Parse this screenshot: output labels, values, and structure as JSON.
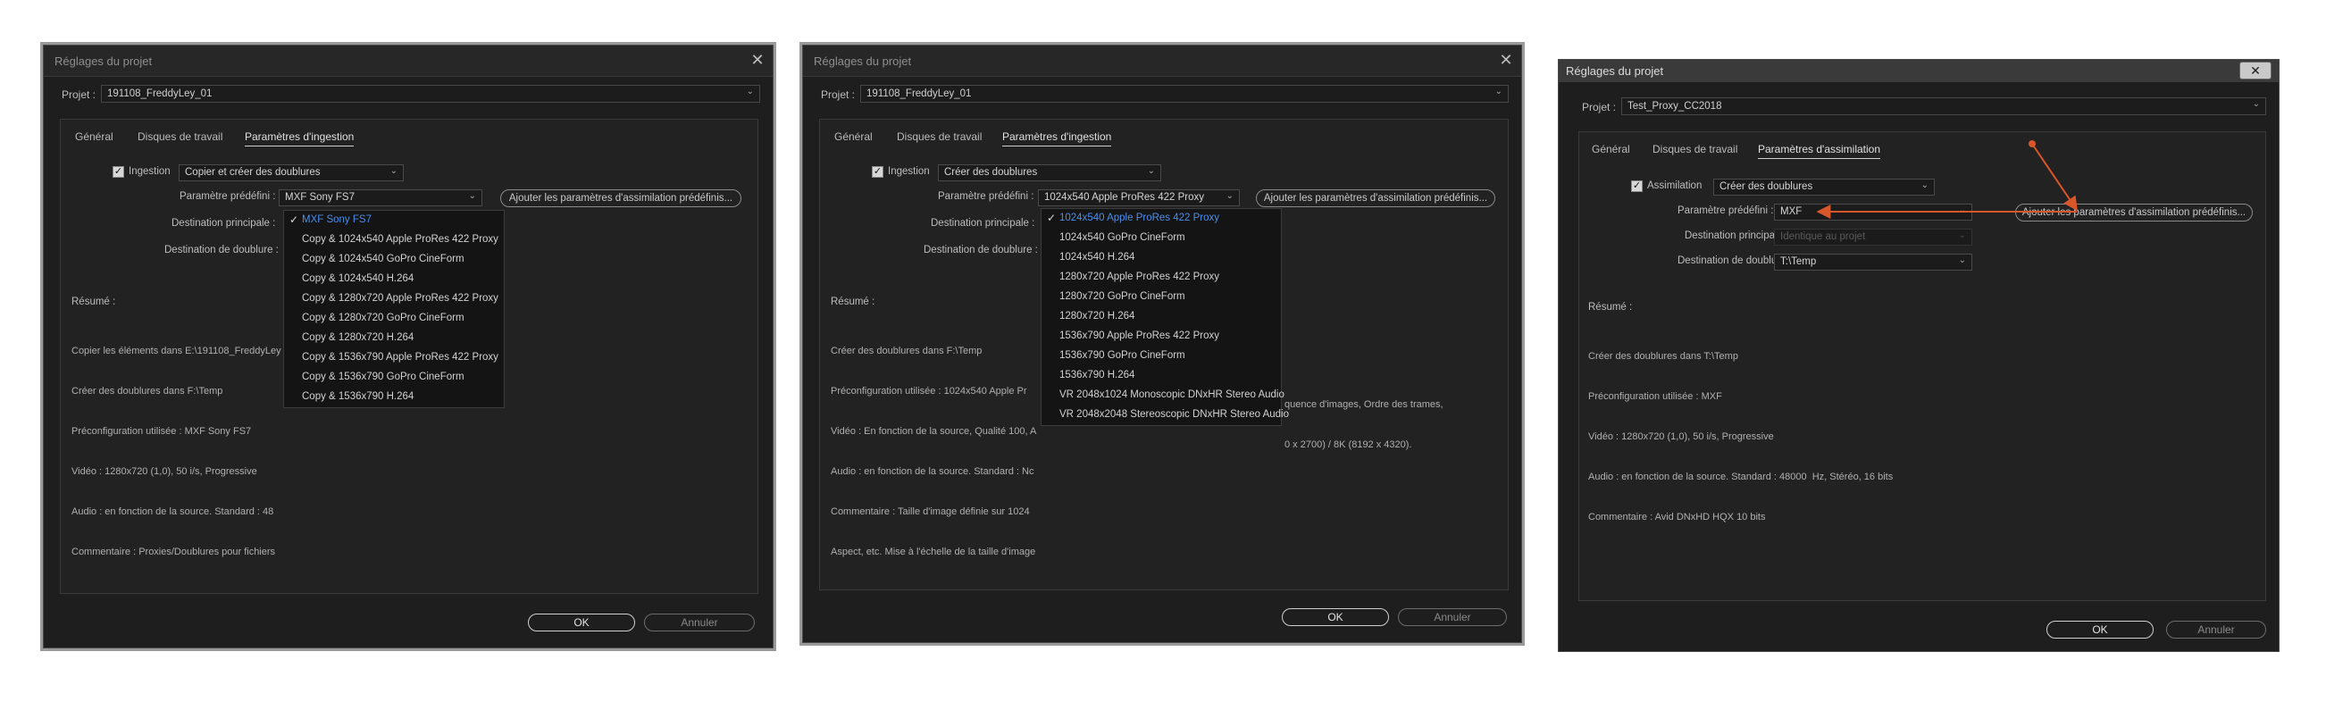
{
  "colors": {
    "dialog_bg": "#1e1e1e",
    "accent_blue": "#4d8ee8",
    "arrow": "#d9562b"
  },
  "dialog1": {
    "title": "Réglages du projet",
    "project_label": "Projet :",
    "project_value": "191108_FreddyLey_01",
    "tabs": [
      "Général",
      "Disques de travail",
      "Paramètres d'ingestion"
    ],
    "ingest_label": "Ingestion",
    "ingest_value": "Copier et créer des doublures",
    "preset_label": "Paramètre prédéfini :",
    "preset_value": "MXF Sony FS7",
    "add_preset_button": "Ajouter les paramètres d'assimilation prédéfinis...",
    "primary_dest_label": "Destination principale :",
    "proxy_dest_label": "Destination de doublure :",
    "summary_label": "Résumé :",
    "summary_lines": [
      "Copier les éléments dans E:\\191108_FreddyLey",
      "Créer des doublures dans F:\\Temp",
      "Préconfiguration utilisée : MXF Sony FS7",
      "Vidéo : 1280x720 (1,0), 50 i/s, Progressive",
      "Audio : en fonction de la source. Standard : 48",
      "Commentaire : Proxies/Doublures pour fichiers"
    ],
    "menu_items": [
      "MXF Sony FS7",
      "Copy & 1024x540 Apple ProRes 422 Proxy",
      "Copy & 1024x540 GoPro CineForm",
      "Copy & 1024x540 H.264",
      "Copy & 1280x720 Apple ProRes 422 Proxy",
      "Copy & 1280x720 GoPro CineForm",
      "Copy & 1280x720 H.264",
      "Copy & 1536x790 Apple ProRes 422 Proxy",
      "Copy & 1536x790 GoPro CineForm",
      "Copy & 1536x790 H.264"
    ],
    "ok": "OK",
    "cancel": "Annuler"
  },
  "dialog2": {
    "title": "Réglages du projet",
    "project_label": "Projet :",
    "project_value": "191108_FreddyLey_01",
    "tabs": [
      "Général",
      "Disques de travail",
      "Paramètres d'ingestion"
    ],
    "ingest_label": "Ingestion",
    "ingest_value": "Créer des doublures",
    "preset_label": "Paramètre prédéfini :",
    "preset_value": "1024x540 Apple ProRes 422 Proxy",
    "add_preset_button": "Ajouter les paramètres d'assimilation prédéfinis...",
    "primary_dest_label": "Destination principale :",
    "proxy_dest_label": "Destination de doublure :",
    "summary_label": "Résumé :",
    "summary_lines": [
      "Créer des doublures dans F:\\Temp",
      "Préconfiguration utilisée : 1024x540 Apple Pr",
      "Vidéo : En fonction de la source, Qualité 100, A",
      "Audio : en fonction de la source. Standard : Nc",
      "Commentaire : Taille d'image définie sur 1024",
      "Aspect, etc. Mise à l'échelle de la taille d'image"
    ],
    "summary_tail_lines": [
      "quence d'images, Ordre des trames,",
      "0 x 2700) / 8K (8192 x 4320)."
    ],
    "menu_items": [
      "1024x540 Apple ProRes 422 Proxy",
      "1024x540 GoPro CineForm",
      "1024x540 H.264",
      "1280x720 Apple ProRes 422 Proxy",
      "1280x720 GoPro CineForm",
      "1280x720 H.264",
      "1536x790 Apple ProRes 422 Proxy",
      "1536x790 GoPro CineForm",
      "1536x790 H.264",
      "VR 2048x1024 Monoscopic DNxHR Stereo Audio",
      "VR 2048x2048 Stereoscopic DNxHR Stereo Audio"
    ],
    "ok": "OK",
    "cancel": "Annuler"
  },
  "dialog3": {
    "title": "Réglages du projet",
    "project_label": "Projet :",
    "project_value": "Test_Proxy_CC2018",
    "tabs": [
      "Général",
      "Disques de travail",
      "Paramètres d'assimilation"
    ],
    "ingest_label": "Assimilation",
    "ingest_value": "Créer des doublures",
    "preset_label": "Paramètre prédéfini :",
    "preset_value": "MXF",
    "add_preset_button": "Ajouter les paramètres d'assimilation prédéfinis...",
    "primary_dest_label": "Destination principale :",
    "primary_dest_value": "Identique au projet",
    "proxy_dest_label": "Destination de doublure :",
    "proxy_dest_value": "T:\\Temp",
    "summary_label": "Résumé :",
    "summary_lines": [
      "Créer des doublures dans T:\\Temp",
      "Préconfiguration utilisée : MXF",
      "Vidéo : 1280x720 (1,0), 50 i/s, Progressive",
      "Audio : en fonction de la source. Standard : 48000  Hz, Stéréo, 16 bits",
      "Commentaire : Avid DNxHD HQX 10 bits"
    ],
    "ok": "OK",
    "cancel": "Annuler"
  }
}
